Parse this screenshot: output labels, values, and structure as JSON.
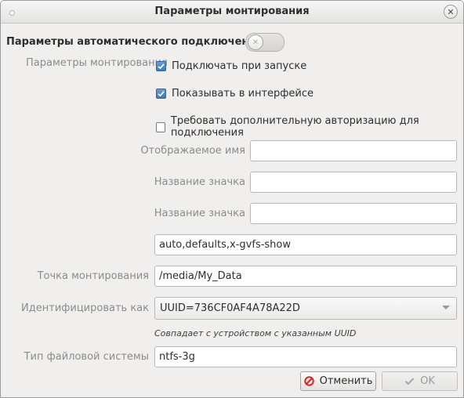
{
  "window": {
    "title": "Параметры монтирования"
  },
  "auto_mount": {
    "heading": "Параметры автоматического подключения",
    "enabled": false
  },
  "mount_options": {
    "label": "Параметры монтирования",
    "checkboxes": [
      {
        "label": "Подключать при запуске",
        "checked": true
      },
      {
        "label": "Показывать в интерфейсе",
        "checked": true
      },
      {
        "label": "Требовать дополнительную авторизацию для подключения",
        "checked": false
      }
    ],
    "display_name_label": "Отображаемое имя",
    "display_name_value": "",
    "icon_name_label": "Название значка",
    "icon_name_value": "",
    "icon_name_symbolic_label": "Название значка",
    "icon_name_symbolic_value": "",
    "options_value": "auto,defaults,x-gvfs-show"
  },
  "mount_point": {
    "label": "Точка монтирования",
    "value": "/media/My_Data"
  },
  "identify_as": {
    "label": "Идентифицировать как",
    "value": "UUID=736CF0AF4A78A22D",
    "hint": "Совпадает с устройством с указанным UUID"
  },
  "filesystem": {
    "label": "Тип файловой системы",
    "value": "ntfs-3g"
  },
  "buttons": {
    "cancel_label": "Отменить",
    "ok_label": "OK"
  },
  "colors": {
    "checkbox_checked": "#3f79bb",
    "cancel_icon": "#d62424"
  }
}
